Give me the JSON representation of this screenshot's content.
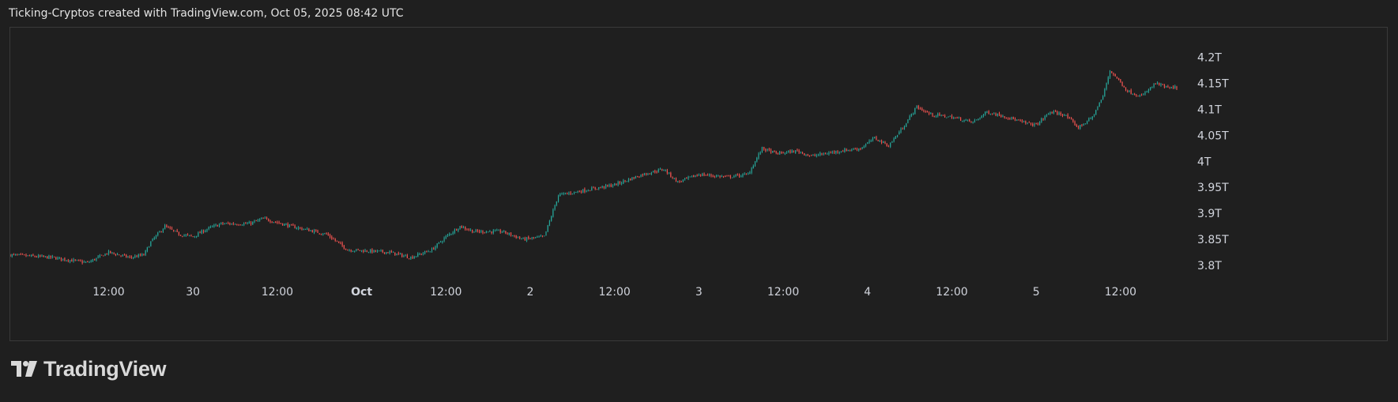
{
  "header": {
    "caption": "Ticking-Cryptos created with TradingView.com, Oct 05, 2025 08:42 UTC"
  },
  "brand": {
    "name": "TradingView",
    "logo_icon": "tradingview-logo-icon"
  },
  "colors": {
    "background": "#1f1f1f",
    "up_candle": "#26a69a",
    "down_candle": "#ef5350",
    "axis_text": "#d1d4dc",
    "frame_border": "#3a3a3a"
  },
  "chart_data": {
    "type": "candlestick",
    "x_ticks": [
      "12:00",
      "30",
      "12:00",
      "Oct",
      "12:00",
      "2",
      "12:00",
      "3",
      "12:00",
      "4",
      "12:00",
      "5",
      "12:00"
    ],
    "x_tick_times": [
      "2025-09-29T12:00",
      "2025-09-30T00:00",
      "2025-09-30T12:00",
      "2025-10-01T00:00",
      "2025-10-01T12:00",
      "2025-10-02T00:00",
      "2025-10-02T12:00",
      "2025-10-03T00:00",
      "2025-10-03T12:00",
      "2025-10-04T00:00",
      "2025-10-04T12:00",
      "2025-10-05T00:00",
      "2025-10-05T12:00"
    ],
    "y_ticks": [
      "4.2T",
      "4.15T",
      "4.1T",
      "4.05T",
      "4T",
      "3.95T",
      "3.9T",
      "3.85T",
      "3.8T"
    ],
    "y_tick_values": [
      4.2,
      4.15,
      4.1,
      4.05,
      4.0,
      3.95,
      3.9,
      3.85,
      3.8
    ],
    "y_unit": "T",
    "x_range": [
      "2025-09-28T22:00",
      "2025-10-05T20:00"
    ],
    "y_range": [
      3.765,
      4.245
    ],
    "grid": false,
    "close_path": [
      [
        "2025-09-28T22:00",
        3.82
      ],
      [
        "2025-09-29T04:00",
        3.815
      ],
      [
        "2025-09-29T09:00",
        3.805
      ],
      [
        "2025-09-29T12:00",
        3.825
      ],
      [
        "2025-09-29T15:00",
        3.815
      ],
      [
        "2025-09-29T17:00",
        3.82
      ],
      [
        "2025-09-29T18:00",
        3.845
      ],
      [
        "2025-09-29T20:00",
        3.875
      ],
      [
        "2025-09-29T22:00",
        3.86
      ],
      [
        "2025-09-30T00:00",
        3.855
      ],
      [
        "2025-09-30T02:00",
        3.87
      ],
      [
        "2025-09-30T04:00",
        3.88
      ],
      [
        "2025-09-30T08:00",
        3.88
      ],
      [
        "2025-09-30T10:00",
        3.89
      ],
      [
        "2025-09-30T14:00",
        3.875
      ],
      [
        "2025-09-30T19:00",
        3.86
      ],
      [
        "2025-09-30T22:00",
        3.83
      ],
      [
        "2025-10-01T04:00",
        3.825
      ],
      [
        "2025-10-01T07:00",
        3.815
      ],
      [
        "2025-10-01T10:00",
        3.83
      ],
      [
        "2025-10-01T12:00",
        3.855
      ],
      [
        "2025-10-01T14:00",
        3.875
      ],
      [
        "2025-10-01T16:00",
        3.865
      ],
      [
        "2025-10-01T20:00",
        3.865
      ],
      [
        "2025-10-01T23:00",
        3.85
      ],
      [
        "2025-10-02T02:00",
        3.855
      ],
      [
        "2025-10-02T04:00",
        3.935
      ],
      [
        "2025-10-02T08:00",
        3.945
      ],
      [
        "2025-10-02T12:00",
        3.955
      ],
      [
        "2025-10-02T16:00",
        3.975
      ],
      [
        "2025-10-02T19:00",
        3.985
      ],
      [
        "2025-10-02T21:00",
        3.96
      ],
      [
        "2025-10-03T00:00",
        3.975
      ],
      [
        "2025-10-03T04:00",
        3.97
      ],
      [
        "2025-10-03T07:00",
        3.975
      ],
      [
        "2025-10-03T09:00",
        4.025
      ],
      [
        "2025-10-03T11:00",
        4.015
      ],
      [
        "2025-10-03T14:00",
        4.02
      ],
      [
        "2025-10-03T16:00",
        4.01
      ],
      [
        "2025-10-03T20:00",
        4.02
      ],
      [
        "2025-10-03T23:00",
        4.025
      ],
      [
        "2025-10-04T01:00",
        4.045
      ],
      [
        "2025-10-04T03:00",
        4.03
      ],
      [
        "2025-10-04T05:00",
        4.065
      ],
      [
        "2025-10-04T07:00",
        4.105
      ],
      [
        "2025-10-04T09:00",
        4.09
      ],
      [
        "2025-10-04T12:00",
        4.085
      ],
      [
        "2025-10-04T15:00",
        4.075
      ],
      [
        "2025-10-04T17:00",
        4.095
      ],
      [
        "2025-10-04T20:00",
        4.085
      ],
      [
        "2025-10-04T22:00",
        4.075
      ],
      [
        "2025-10-05T00:00",
        4.07
      ],
      [
        "2025-10-05T02:00",
        4.095
      ],
      [
        "2025-10-05T04:00",
        4.09
      ],
      [
        "2025-10-05T06:00",
        4.065
      ],
      [
        "2025-10-05T08:00",
        4.085
      ],
      [
        "2025-10-05T09:30",
        4.125
      ],
      [
        "2025-10-05T10:30",
        4.175
      ],
      [
        "2025-10-05T11:30",
        4.16
      ],
      [
        "2025-10-05T13:00",
        4.135
      ],
      [
        "2025-10-05T15:00",
        4.125
      ],
      [
        "2025-10-05T17:00",
        4.15
      ],
      [
        "2025-10-05T19:00",
        4.14
      ],
      [
        "2025-10-05T21:00",
        4.145
      ],
      [
        "2025-10-05T23:00",
        4.13
      ],
      [
        "2025-10-06T01:00",
        4.115
      ]
    ]
  }
}
